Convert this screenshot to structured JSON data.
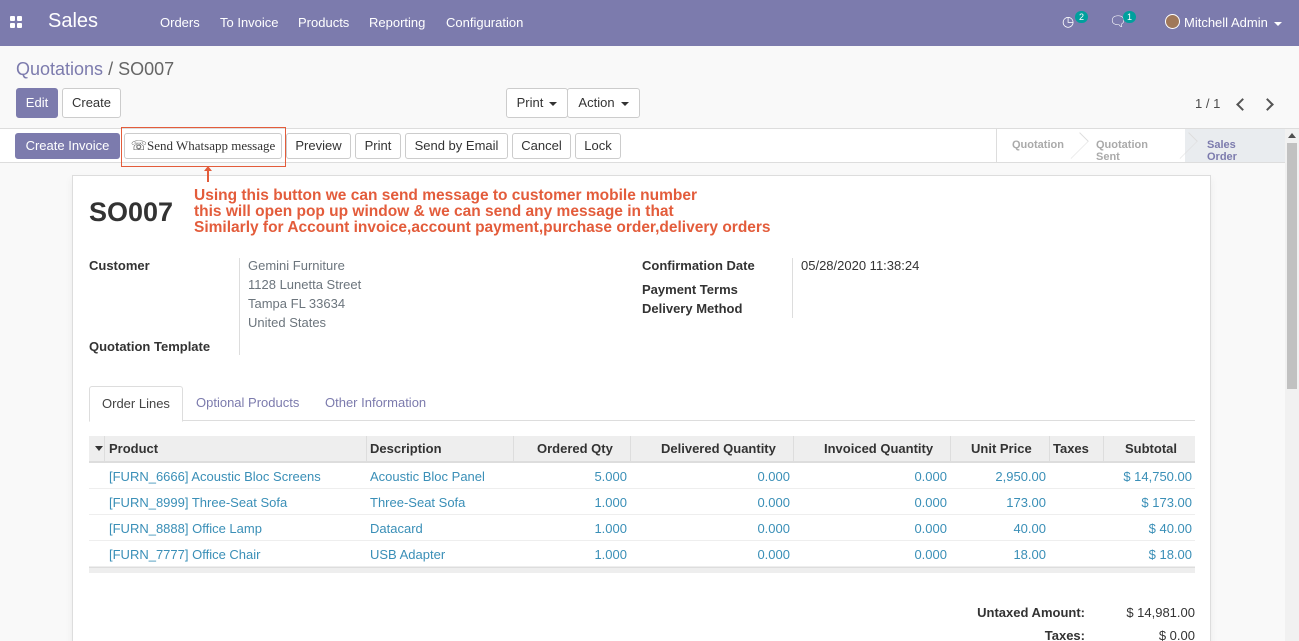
{
  "navbar": {
    "brand": "Sales",
    "menu": [
      "Orders",
      "To Invoice",
      "Products",
      "Reporting",
      "Configuration"
    ],
    "activity_count": "2",
    "message_count": "1",
    "user": "Mitchell Admin"
  },
  "breadcrumb": {
    "parent": "Quotations",
    "separator": "/",
    "current": "SO007"
  },
  "toolbar": {
    "edit": "Edit",
    "create": "Create",
    "print": "Print",
    "action": "Action",
    "pager": "1 / 1"
  },
  "status_buttons": {
    "create_invoice": "Create Invoice",
    "whatsapp": "Send Whatsapp message",
    "preview": "Preview",
    "print": "Print",
    "send_email": "Send by Email",
    "cancel": "Cancel",
    "lock": "Lock"
  },
  "stages": [
    "Quotation",
    "Quotation Sent",
    "Sales Order"
  ],
  "annotation": [
    "Using this button we can send message to customer mobile number",
    "this will open pop up window & we can send any message in that",
    "Similarly for Account invoice,account payment,purchase order,delivery orders"
  ],
  "order": {
    "name": "SO007",
    "customer_label": "Customer",
    "customer_lines": [
      "Gemini Furniture",
      "1128 Lunetta Street",
      "Tampa FL 33634",
      "United States"
    ],
    "template_label": "Quotation Template",
    "confirmation_label": "Confirmation Date",
    "confirmation_value": "05/28/2020 11:38:24",
    "payment_terms_label": "Payment Terms",
    "delivery_label": "Delivery Method"
  },
  "tabs": [
    "Order Lines",
    "Optional Products",
    "Other Information"
  ],
  "table": {
    "headers": [
      "Product",
      "Description",
      "Ordered Qty",
      "Delivered Quantity",
      "Invoiced Quantity",
      "Unit Price",
      "Taxes",
      "Subtotal"
    ],
    "rows": [
      [
        "[FURN_6666] Acoustic Bloc Screens",
        "Acoustic Bloc Panel",
        "5.000",
        "0.000",
        "0.000",
        "2,950.00",
        "",
        "$ 14,750.00"
      ],
      [
        "[FURN_8999] Three-Seat Sofa",
        "Three-Seat Sofa",
        "1.000",
        "0.000",
        "0.000",
        "173.00",
        "",
        "$ 173.00"
      ],
      [
        "[FURN_8888] Office Lamp",
        "Datacard",
        "1.000",
        "0.000",
        "0.000",
        "40.00",
        "",
        "$ 40.00"
      ],
      [
        "[FURN_7777] Office Chair",
        "USB Adapter",
        "1.000",
        "0.000",
        "0.000",
        "18.00",
        "",
        "$ 18.00"
      ]
    ]
  },
  "totals": {
    "untaxed_label": "Untaxed Amount:",
    "untaxed_value": "$ 14,981.00",
    "taxes_label": "Taxes:",
    "taxes_value": "$ 0.00"
  },
  "colors": {
    "brand": "#7c7bad",
    "annotation": "#e35c3b",
    "link": "#3a8fb7"
  }
}
